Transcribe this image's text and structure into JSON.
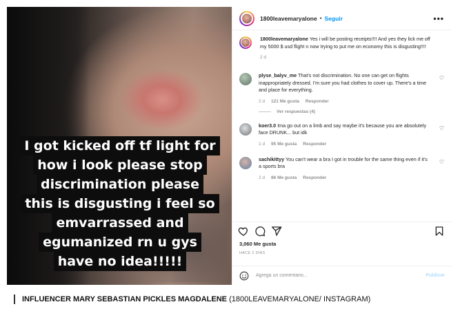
{
  "photo": {
    "caption_lines": [
      "I got kicked off tf light for",
      "how i look please stop",
      "discrimination please",
      "this is disgusting i feel so",
      "emvarrassed and",
      "egumanized rn u gys",
      "have no idea!!!!!"
    ]
  },
  "header": {
    "username": "1800leavemaryalone",
    "separator": "•",
    "follow_label": "Seguir",
    "more_label": "•••"
  },
  "caption_comment": {
    "username": "1800leavemaryalone",
    "text": "Yes i will be posting receipts!!!! And yes they lick me off my 5000 $ usd flight n now trying to put me on economy this is disgusting!!!!",
    "time": "2 d"
  },
  "comments": [
    {
      "username": "plyse_balyv_me",
      "text": "That's not discrimination. No one can get on flights inappropriately dressed. I'm sure you had clothes to cover up. There's a time and place for everything.",
      "time": "2 d",
      "likes": "121 Me gusta",
      "reply_label": "Responder",
      "avatar_color": "#7f9a86"
    },
    {
      "username": "koer3.0",
      "text": "Ima go out on a limb and say maybe it's because you are absolutely face DRUNK... but idk",
      "time": "1 d",
      "likes": "95 Me gusta",
      "reply_label": "Responder",
      "avatar_color": "#9aa0a6"
    },
    {
      "username": "sachikittyy",
      "text": "You can't wear a bra I got in trouble for the same thing even if it's a sports bra",
      "time": "2 d",
      "likes": "86 Me gusta",
      "reply_label": "Responder",
      "avatar_color": "#8da9c4"
    }
  ],
  "view_replies_label": "Ver respuestas (4)",
  "likes_total": "3,060 Me gusta",
  "posted_ago": "HACE 2 DÍAS",
  "add_comment": {
    "placeholder": "Agrega un comentario...",
    "publish_label": "Publicar"
  },
  "credit": {
    "bold": "INFLUENCER MARY SEBASTIAN PICKLES MAGDALENE",
    "rest": " (1800LEAVEMARYALONE/ INSTAGRAM)"
  },
  "colors": {
    "link_blue": "#0095f6",
    "publish_disabled": "#b2dffc",
    "meta_gray": "#8e8e8e"
  }
}
